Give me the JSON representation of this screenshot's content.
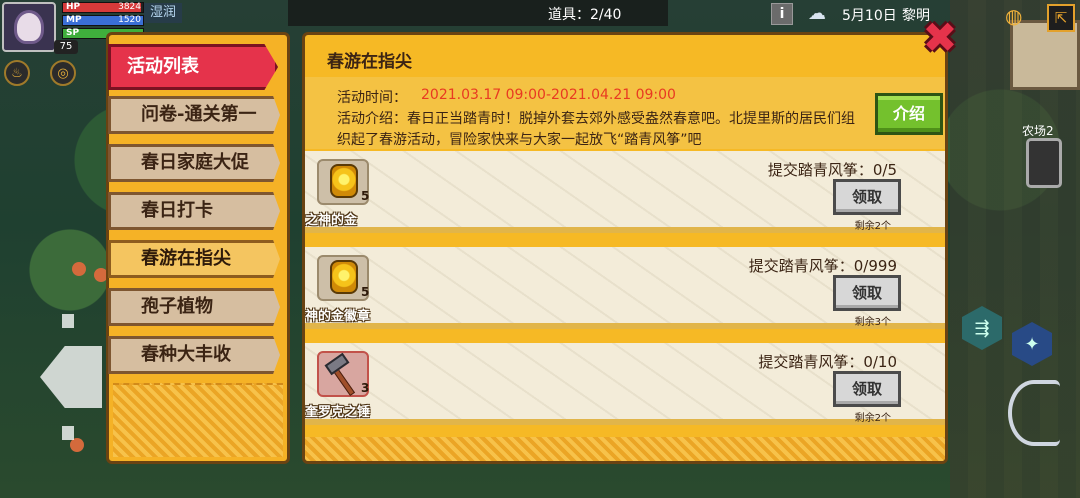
{
  "hud": {
    "hp_label": "HP",
    "hp_value": "3824",
    "mp_label": "MP",
    "mp_value": "1520",
    "sp_label": "SP",
    "sp_value": "",
    "level": "75",
    "weather_text": "湿润"
  },
  "topbar": {
    "items": "道具：2/40",
    "date": "5月10日",
    "time_of_day": "黎明",
    "info_icon": "i"
  },
  "farm_label": "农场2",
  "sidebar": {
    "header": "活动列表",
    "items": [
      {
        "label": "问卷-通关第一"
      },
      {
        "label": "春日家庭大促"
      },
      {
        "label": "春日打卡"
      },
      {
        "label": "春游在指尖"
      },
      {
        "label": "孢子植物"
      },
      {
        "label": "春种大丰收"
      }
    ],
    "active_index": 3
  },
  "panel": {
    "title": "春游在指尖",
    "time_label": "活动时间：",
    "time_value": "2021.03.17 09:00-2021.04.21 09:00",
    "desc": "活动介绍：春日正当踏青时！脱掉外套去郊外感受盎然春意吧。北提里斯的居民们组织起了春游活动，冒险家快来与大家一起放飞“踏青风筝”吧",
    "intro_button": "介绍",
    "close_icon": "close-icon"
  },
  "rewards": [
    {
      "item_name": "之神的金",
      "count": "5",
      "submit": "提交踏青风筝：0/5",
      "button": "领取",
      "remain": "剩余2个",
      "icon": "gold-medal-icon"
    },
    {
      "item_name": "神的金徽章",
      "count": "5",
      "submit": "提交踏青风筝：0/999",
      "button": "领取",
      "remain": "剩余3个",
      "icon": "gold-medal-icon"
    },
    {
      "item_name": "奎罗克之锤",
      "count": "3",
      "submit": "提交踏青风筝：0/10",
      "button": "领取",
      "remain": "剩余2个",
      "icon": "hammer-icon"
    }
  ],
  "colors": {
    "accent": "#f6b925",
    "header_red": "#e5334b",
    "time_red": "#e83a22",
    "intro_green": "#74c12d"
  }
}
